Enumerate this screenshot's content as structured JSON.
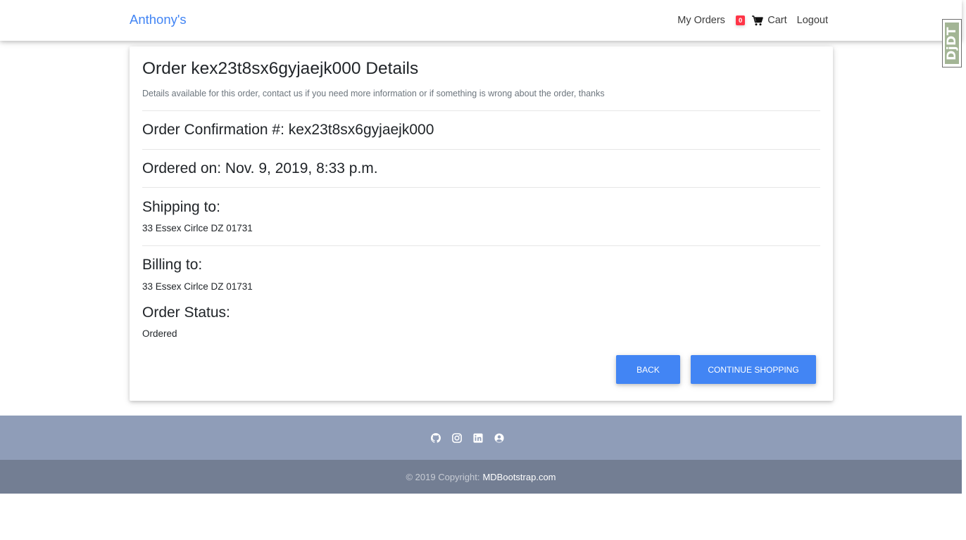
{
  "navbar": {
    "brand": "Anthony's",
    "my_orders": "My Orders",
    "cart_count": "0",
    "cart": "Cart",
    "logout": "Logout",
    "icons": {
      "cart": "shopping-cart-icon"
    }
  },
  "debug_toolbar": {
    "label": "DjDT"
  },
  "order": {
    "title": "Order kex23t8sx6gyjaejk000 Details",
    "subtitle": "Details available for this order, contact us if you need more information or if something is wrong about the order, thanks",
    "confirmation": "Order Confirmation #: kex23t8sx6gyjaejk000",
    "ordered_on": "Ordered on: Nov. 9, 2019, 8:33 p.m.",
    "shipping_heading": "Shipping to:",
    "shipping_address": "33 Essex Cirlce DZ 01731",
    "billing_heading": "Billing to:",
    "billing_address": "33 Essex Cirlce DZ 01731",
    "status_heading": "Order Status:",
    "status": "Ordered"
  },
  "buttons": {
    "back": "Back",
    "continue": "Continue shopping"
  },
  "footer": {
    "social_icons": [
      "github-icon",
      "instagram-icon",
      "linkedin-icon",
      "user-circle-icon"
    ],
    "copyright_prefix": "© 2019 Copyright:",
    "copyright_link": "MDBootstrap.com"
  },
  "colors": {
    "primary": "#4285f4",
    "badge": "#ff3547",
    "footer_top": "#8f9db8",
    "footer_bottom": "#737e93"
  }
}
